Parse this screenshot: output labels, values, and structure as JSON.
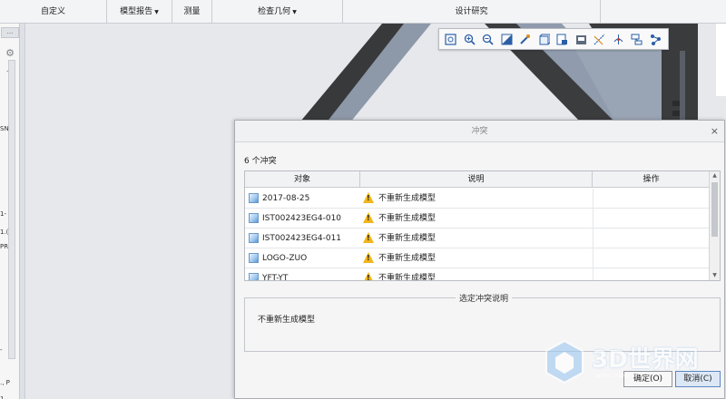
{
  "ribbon": {
    "groups": [
      {
        "label": "自定义",
        "dropdown": false
      },
      {
        "label": "模型报告",
        "dropdown": true
      },
      {
        "label": "测量",
        "dropdown": false
      },
      {
        "label": "检查几何",
        "dropdown": true
      },
      {
        "label": "设计研究",
        "dropdown": false
      }
    ]
  },
  "left_panel": {
    "tab_label": "...",
    "clipped_texts": [
      "SN",
      "1-",
      "1.(",
      "PR",
      "-",
      "., P",
      "1"
    ]
  },
  "graphics_toolbar": {
    "buttons": [
      "refit-icon",
      "zoom-in-icon",
      "zoom-out-icon",
      "repaint-icon",
      "view-manager-icon",
      "display-style-icon",
      "saved-views-icon",
      "named-views-icon",
      "datum-display-icon",
      "spin-center-icon",
      "annotation-display-icon",
      "simulation-display-icon"
    ]
  },
  "dialog": {
    "title": "冲突",
    "close_symbol": "×",
    "conflict_count": "6 个冲突",
    "columns": {
      "object": "对象",
      "description": "说明",
      "action": "操作"
    },
    "rows": [
      {
        "object": "2017-08-25",
        "description": "不重新生成模型",
        "action": ""
      },
      {
        "object": "IST002423EG4-010",
        "description": "不重新生成模型",
        "action": ""
      },
      {
        "object": "IST002423EG4-011",
        "description": "不重新生成模型",
        "action": ""
      },
      {
        "object": "LOGO-ZUO",
        "description": "不重新生成模型",
        "action": ""
      },
      {
        "object": "YFT-YT",
        "description": "不重新生成模型",
        "action": ""
      }
    ],
    "details_legend": "选定冲突说明",
    "details_text": "不重新生成模型",
    "ok_label": "确定(O)",
    "cancel_label": "取消(C)"
  },
  "watermark": {
    "brand": "3D世界网",
    "sub": "www.3dportal.cn"
  },
  "colors": {
    "accent": "#2b5ea6",
    "warning": "#f2b51b",
    "beam_dark": "#3a3b3d",
    "beam_light": "#8e9aac"
  }
}
